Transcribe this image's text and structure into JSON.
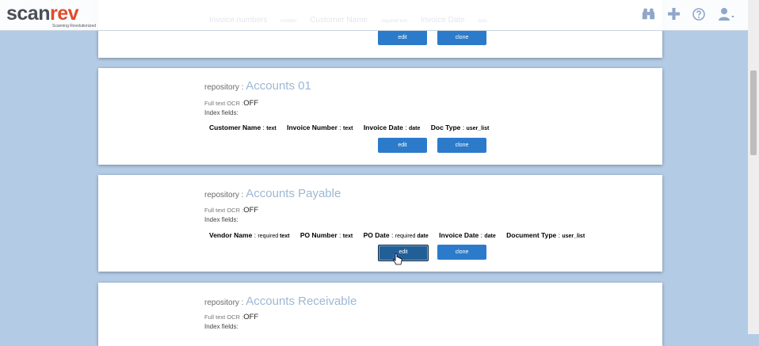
{
  "brand": {
    "logo_main": "scan",
    "logo_accent": "rev",
    "tagline": "Scanning Revolutionized"
  },
  "nav": {
    "icons": [
      "binoculars-icon",
      "plus-icon",
      "help-circle-icon",
      "user-icon"
    ]
  },
  "partial_top": {
    "fields": [
      {
        "name": "Invoice numbers",
        "type": "number"
      },
      {
        "name": "Customer Name",
        "type": "required text"
      },
      {
        "name": "Invoice Date",
        "type": "date"
      }
    ],
    "edit_label": "edit",
    "clone_label": "clone"
  },
  "repositories": [
    {
      "repo_label": "repository :",
      "name": "Accounts 01",
      "ocr_label": "Full text OCR :",
      "ocr_value": "OFF",
      "index_label": "Index fields:",
      "fields": [
        {
          "name": "Customer Name",
          "sep": " : ",
          "required": "",
          "type": "text"
        },
        {
          "name": "Invoice Number",
          "sep": " : ",
          "required": "",
          "type": "text"
        },
        {
          "name": "Invoice Date",
          "sep": " : ",
          "required": "",
          "type": "date"
        },
        {
          "name": "Doc Type",
          "sep": " : ",
          "required": "",
          "type": "user_list"
        }
      ],
      "edit_label": "edit",
      "clone_label": "clone"
    },
    {
      "repo_label": "repository :",
      "name": "Accounts Payable",
      "ocr_label": "Full text OCR :",
      "ocr_value": "OFF",
      "index_label": "Index fields:",
      "fields": [
        {
          "name": "Vendor Name",
          "sep": " : ",
          "required": "required ",
          "type": "text"
        },
        {
          "name": "PO Number",
          "sep": " : ",
          "required": "",
          "type": "text"
        },
        {
          "name": "PO Date",
          "sep": " : ",
          "required": "required ",
          "type": "date"
        },
        {
          "name": "Invoice Date",
          "sep": " : ",
          "required": "",
          "type": "date"
        },
        {
          "name": "Document Type",
          "sep": " : ",
          "required": "",
          "type": "user_list"
        }
      ],
      "edit_label": "edit",
      "clone_label": "clone"
    },
    {
      "repo_label": "repository :",
      "name": "Accounts Receivable",
      "ocr_label": "Full text OCR :",
      "ocr_value": "OFF",
      "index_label": "Index fields:"
    }
  ]
}
